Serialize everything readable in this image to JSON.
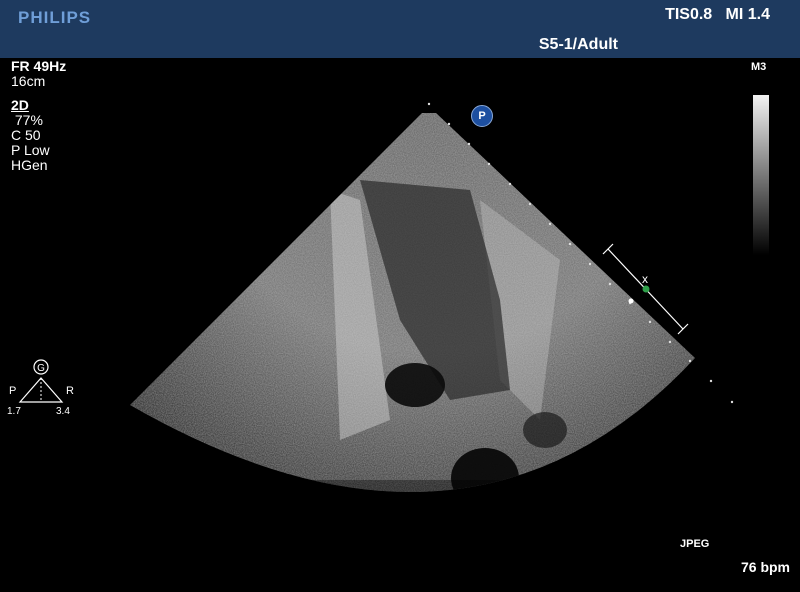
{
  "header": {
    "brand": "PHILIPS",
    "safety": "TIS0.8   MI 1.4",
    "probe_preset": "S5-1/Adult"
  },
  "parameters": {
    "frame_rate": "FR 49Hz",
    "depth": "16cm",
    "mode": "2D",
    "gain": " 77%",
    "compression": "C 50",
    "power": "P Low",
    "frequency": "HGen"
  },
  "map_label": "M3",
  "orientation": {
    "center_label": "G",
    "left_label": "P",
    "right_label": "R",
    "left_value": "1.7",
    "right_value": "3.4"
  },
  "probe_marker": "P",
  "caliper_label": "x",
  "format_label": "JPEG",
  "heart_rate": "76 bpm",
  "colors": {
    "header_bg": "#1e3a5f",
    "brand": "#6f9ed8",
    "probe_marker": "#1d4fa0",
    "caliper_dot": "#2fa04a"
  }
}
